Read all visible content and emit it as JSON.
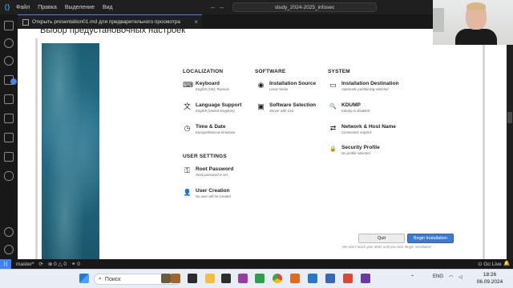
{
  "titlebar": {
    "menu": [
      "Файл",
      "Правка",
      "Выделение",
      "Вид"
    ],
    "nav": "← →",
    "search_text": "study_2024-2025_infosec"
  },
  "tab": {
    "label": "Открыть presentation01.md для предварительного просмотра",
    "close": "×"
  },
  "slide": {
    "title": "Выбор предустановочных настроек"
  },
  "installer": {
    "sections": {
      "localization": "LOCALIZATION",
      "software": "SOFTWARE",
      "system": "SYSTEM",
      "user_settings": "USER SETTINGS"
    },
    "spokes": {
      "keyboard": {
        "icon": "keyboard-icon",
        "glyph": "⌨",
        "title": "Keyboard",
        "status": "English (UK), Russian"
      },
      "language": {
        "icon": "language-icon",
        "glyph": "文",
        "title": "Language Support",
        "status": "English (United Kingdom)"
      },
      "time": {
        "icon": "clock-icon",
        "glyph": "◷",
        "title": "Time & Date",
        "status": "Europe/Moscow timezone"
      },
      "source": {
        "icon": "disc-icon",
        "glyph": "◉",
        "title": "Installation Source",
        "status": "Local media"
      },
      "selection": {
        "icon": "package-icon",
        "glyph": "▣",
        "title": "Software Selection",
        "status": "Server with GUI"
      },
      "destination": {
        "icon": "harddrive-icon",
        "glyph": "▭",
        "title": "Installation Destination",
        "status": "Automatic partitioning selected"
      },
      "kdump": {
        "icon": "search-icon",
        "glyph": "🔍",
        "title": "KDUMP",
        "status": "Kdump is disabled"
      },
      "network": {
        "icon": "network-icon",
        "glyph": "⇄",
        "title": "Network & Host Name",
        "status": "Connected: enp0s3"
      },
      "security": {
        "icon": "lock-icon",
        "glyph": "🔒",
        "title": "Security Profile",
        "status": "No profile selected"
      },
      "root": {
        "icon": "key-icon",
        "glyph": "⚿",
        "title": "Root Password",
        "status": "Root password is set"
      },
      "user": {
        "icon": "user-icon",
        "glyph": "👤",
        "title": "User Creation",
        "status": "No user will be created"
      }
    },
    "quit_label": "Quit",
    "begin_label": "Begin Installation",
    "footnote": "We won't touch your disks until you click 'Begin Installation'."
  },
  "statusbar": {
    "branch": "master*",
    "sync": "⟳",
    "problems": "⊗ 0 △ 0",
    "ports": "⚭ 0",
    "golive": "⊙ Go Live",
    "bell": "🔔"
  },
  "taskbar": {
    "search_placeholder": "Поиск",
    "language": "ENG",
    "time": "18:26",
    "date": "06.09.2024"
  },
  "colors": {
    "accent": "#3b82f6",
    "begin_button": "#3d7bd1",
    "sidebar_teal": "#26708a"
  }
}
